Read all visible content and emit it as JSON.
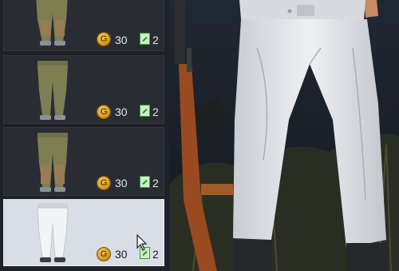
{
  "items": [
    {
      "price": "30",
      "tickets": "2",
      "color": "olive",
      "selected": false
    },
    {
      "price": "30",
      "tickets": "2",
      "color": "olive",
      "selected": false
    },
    {
      "price": "30",
      "tickets": "2",
      "color": "olive",
      "selected": false
    },
    {
      "price": "30",
      "tickets": "2",
      "color": "white",
      "selected": true
    }
  ],
  "colors": {
    "olive_pants": "#7d7f52",
    "white_pants": "#e7e8ec",
    "coin": "#d9a12a",
    "ticket": "#3d9a3d",
    "selected_card": "#d9dde6"
  },
  "icons": {
    "currency": "coin-icon",
    "ticket": "ticket-icon",
    "cursor": "mouse-cursor-icon"
  }
}
